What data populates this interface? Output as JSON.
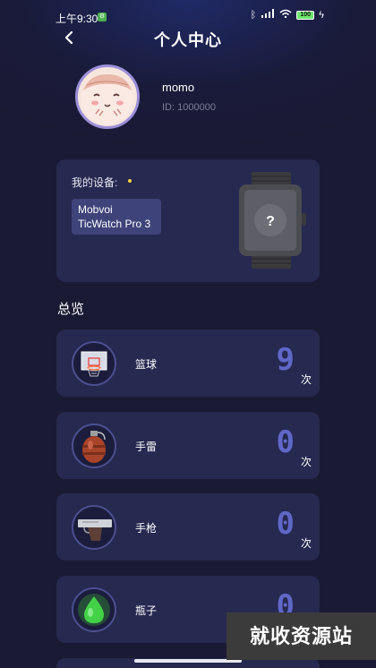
{
  "status_bar": {
    "time": "上午9:30",
    "battery": "100"
  },
  "header": {
    "title": "个人中心"
  },
  "user": {
    "name": "momo",
    "id": "ID: 1000000"
  },
  "device": {
    "label": "我的设备:",
    "name_line1": "Mobvoi",
    "name_line2": "TicWatch Pro 3",
    "watch_face_symbol": "?"
  },
  "overview": {
    "title": "总览",
    "items": [
      {
        "name": "篮球",
        "count": "9",
        "unit": "次",
        "icon": "basketball-hoop-icon"
      },
      {
        "name": "手雷",
        "count": "0",
        "unit": "次",
        "icon": "grenade-icon"
      },
      {
        "name": "手枪",
        "count": "0",
        "unit": "次",
        "icon": "pistol-icon"
      },
      {
        "name": "瓶子",
        "count": "0",
        "unit": "次",
        "icon": "bottle-icon"
      }
    ]
  },
  "watermark": "就收资源站",
  "colors": {
    "background": "#1a1a34",
    "card": "#262950",
    "accent_number": "#5f67c8",
    "device_dot": "#f5d442"
  }
}
